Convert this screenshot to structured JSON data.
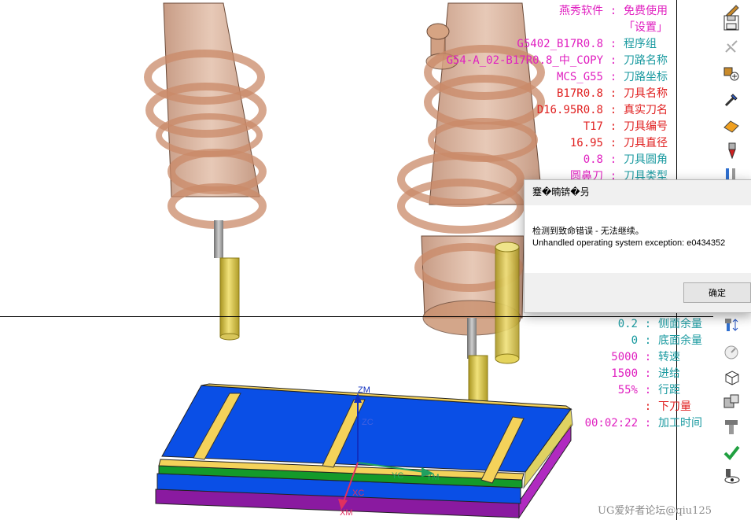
{
  "info_panel": {
    "rows": [
      {
        "value": "燕秀软件",
        "sep": ":",
        "label": "免费使用",
        "vcolor": "#e020c0",
        "lcolor": "#e020c0"
      },
      {
        "value": "",
        "sep": "",
        "label": "「设置」",
        "vcolor": "#e020c0",
        "lcolor": "#e020c0"
      },
      {
        "value": "G5402_B17R0.8",
        "sep": ":",
        "label": "程序组",
        "vcolor": "#e020c0",
        "lcolor": "#1a9aa0"
      },
      {
        "value": "G54-A_02-B17R0.8_中_COPY",
        "sep": ":",
        "label": "刀路名称",
        "vcolor": "#e020c0",
        "lcolor": "#1a9aa0"
      },
      {
        "value": "MCS_G55",
        "sep": ":",
        "label": "刀路坐标",
        "vcolor": "#e020c0",
        "lcolor": "#1a9aa0"
      },
      {
        "value": "B17R0.8",
        "sep": ":",
        "label": "刀具名称",
        "vcolor": "#e02020",
        "lcolor": "#e02020"
      },
      {
        "value": "D16.95R0.8",
        "sep": ":",
        "label": "真实刀名",
        "vcolor": "#e02020",
        "lcolor": "#e02020"
      },
      {
        "value": "T17",
        "sep": ":",
        "label": "刀具编号",
        "vcolor": "#e02020",
        "lcolor": "#e02020"
      },
      {
        "value": "16.95",
        "sep": ":",
        "label": "刀具直径",
        "vcolor": "#e02020",
        "lcolor": "#e02020"
      },
      {
        "value": "0.8",
        "sep": ":",
        "label": "刀具圆角",
        "vcolor": "#e020c0",
        "lcolor": "#1a9aa0"
      },
      {
        "value": "圆鼻刀",
        "sep": ":",
        "label": "刀具类型",
        "vcolor": "#e020c0",
        "lcolor": "#1a9aa0"
      }
    ],
    "lower_rows": [
      {
        "value": "0.2",
        "sep": ":",
        "label": "侧面余量",
        "vcolor": "#1a9aa0",
        "lcolor": "#1a9aa0"
      },
      {
        "value": "0",
        "sep": ":",
        "label": "底面余量",
        "vcolor": "#1a9aa0",
        "lcolor": "#1a9aa0"
      },
      {
        "value": "5000",
        "sep": ":",
        "label": "转速",
        "vcolor": "#e020c0",
        "lcolor": "#1a9aa0"
      },
      {
        "value": "1500",
        "sep": ":",
        "label": "进给",
        "vcolor": "#e020c0",
        "lcolor": "#1a9aa0"
      },
      {
        "value": "55%",
        "sep": ":",
        "label": "行距",
        "vcolor": "#e020c0",
        "lcolor": "#1a9aa0"
      },
      {
        "value": "",
        "sep": ":",
        "label": "下刀量",
        "vcolor": "#e02020",
        "lcolor": "#e02020"
      },
      {
        "value": "00:02:22",
        "sep": ":",
        "label": "加工时间",
        "vcolor": "#e020c0",
        "lcolor": "#1a9aa0"
      }
    ]
  },
  "dialog": {
    "title": "蹇�暔锛�叧",
    "message_cn": "检测到致命错误 - 无法继续。",
    "message_en": "Unhandled operating system exception: e0434352",
    "ok_label": "确定"
  },
  "axes": {
    "zm": "ZM",
    "zc": "ZC",
    "yc": "YC",
    "ym": "YM",
    "xc": "XC",
    "xm": "XM"
  },
  "watermark": "UG爱好者论坛@qiu125",
  "toolbar": {
    "icons": [
      "wrench-icon",
      "save-icon",
      "disabled-link-icon",
      "add-operation-icon",
      "eyedropper-icon",
      "eraser-icon",
      "drill-bit-icon",
      "tool-list-icon",
      "tool-stock-icon",
      "gauge-icon",
      "cube-icon",
      "folder-icon",
      "end-mill-icon",
      "checkmark-icon",
      "view-icon"
    ]
  },
  "colors": {
    "plate_blue": "#0a4fe6",
    "stripe_green": "#149a2a",
    "stripe_yellow": "#f4d25a",
    "side_purple": "#8a1aa0",
    "holder": "#c9906e",
    "tool_gold": "#d8c040"
  }
}
